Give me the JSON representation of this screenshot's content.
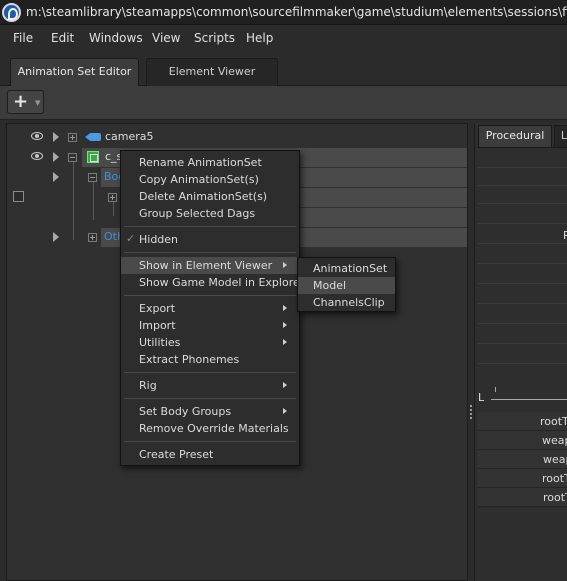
{
  "window": {
    "title": "m:\\steamlibrary\\steamapps\\common\\sourcefilmmaker\\game\\studium\\elements\\sessions\\fina"
  },
  "menubar": [
    "File",
    "Edit",
    "Windows",
    "View",
    "Scripts",
    "Help"
  ],
  "tabs": [
    "Animation Set Editor",
    "Element Viewer"
  ],
  "toolbar": {
    "add_label": "+"
  },
  "tree": {
    "camera_label": "camera5",
    "model_label": "c_s",
    "body_label": "Bod",
    "other_label": "Oth"
  },
  "context_menu": {
    "rename": "Rename AnimationSet",
    "copy": "Copy AnimationSet(s)",
    "delete": "Delete AnimationSet(s)",
    "group": "Group Selected Dags",
    "hidden": "Hidden",
    "show_in_element_viewer": "Show in Element Viewer",
    "show_game_model": "Show Game Model in Explorer",
    "export": "Export",
    "import": "Import",
    "utilities": "Utilities",
    "extract_phonemes": "Extract Phonemes",
    "rig": "Rig",
    "set_body_groups": "Set Body Groups",
    "remove_override": "Remove Override Materials",
    "create_preset": "Create Preset",
    "check_mark": "✓"
  },
  "submenu": {
    "animation_set": "AnimationSet",
    "model": "Model",
    "channels_clip": "ChannelsClip"
  },
  "right_panel": {
    "tab_procedural": "Procedural",
    "tab_partial": "L",
    "row_p": "P",
    "scale_label": "L",
    "controls": [
      "rootTra",
      "weapo",
      "weap",
      "rootTr",
      "rootTr"
    ]
  }
}
